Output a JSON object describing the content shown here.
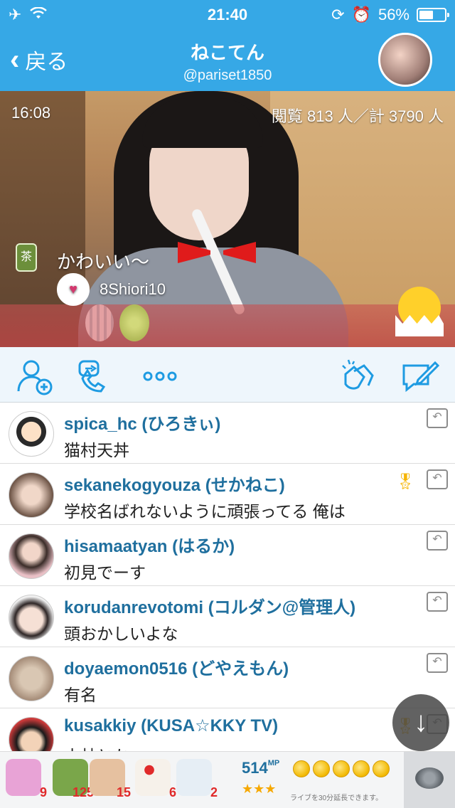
{
  "status_bar": {
    "time": "21:40",
    "battery": "56%",
    "battery_level": 0.56
  },
  "nav": {
    "back_label": "戻る",
    "title": "ねこてん",
    "subtitle": "@pariset1850"
  },
  "video": {
    "elapsed": "16:08",
    "views": "閲覧 813 人／計 3790 人",
    "gift_item_label": "茶",
    "gift_message": "かわいい〜",
    "gift_user": "8Shiori10"
  },
  "comments": [
    {
      "name": "spica_hc (ひろきぃ)",
      "message": "猫村天丼",
      "avatar_color": "#ffffff"
    },
    {
      "name": "sekanekogyouza (せかねこ)",
      "message": "学校名ばれないように頑張ってる 俺は",
      "avatar_color": "#e9d4c5",
      "badge": true
    },
    {
      "name": "hisamaatyan (はるか)",
      "message": "初見でーす",
      "avatar_color": "#c9a8a0"
    },
    {
      "name": "korudanrevotomi (コルダン@管理人)",
      "message": "頭おかしいよな",
      "avatar_color": "#f2e0d7"
    },
    {
      "name": "doyaemon0516 (どやえもん)",
      "message": "有名",
      "avatar_color": "#d8c8b5"
    },
    {
      "name": "kusakkiy (KUSA☆KKY TV)",
      "message": "小林とか",
      "avatar_color": "#f3d3b8",
      "badge": true
    }
  ],
  "gifts": [
    {
      "count": "9",
      "color": "#e8a3d6"
    },
    {
      "count": "125",
      "color": "#7aa64a"
    },
    {
      "count": "15",
      "color": "#e6c1a0"
    },
    {
      "count": "6",
      "color": "#f6f1ea"
    },
    {
      "count": "2",
      "color": "#e6eef5"
    }
  ],
  "points": {
    "value": "514",
    "unit": "MP",
    "stars": "★★★",
    "extend_note": "ライブを30分延長できます。"
  },
  "colors": {
    "header": "#36a8e6",
    "accent_blue": "#1e9be2",
    "username": "#1f6f9e"
  }
}
